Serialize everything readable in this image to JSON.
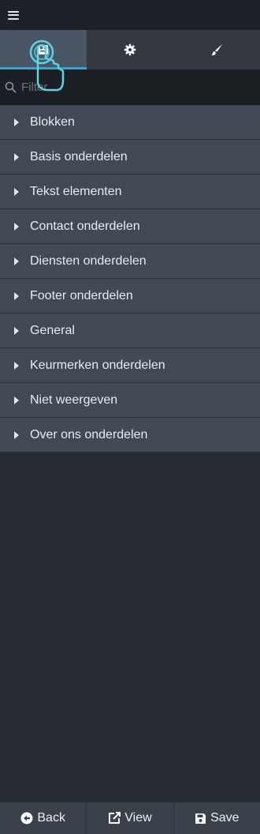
{
  "header": {
    "menu_icon": "hamburger-icon"
  },
  "tabs": [
    {
      "icon": "blocks-icon",
      "active": true
    },
    {
      "icon": "gear-icon",
      "active": false
    },
    {
      "icon": "brush-icon",
      "active": false
    }
  ],
  "filter": {
    "placeholder": "Filter",
    "value": ""
  },
  "categories": [
    {
      "label": "Blokken"
    },
    {
      "label": "Basis onderdelen"
    },
    {
      "label": "Tekst elementen"
    },
    {
      "label": "Contact onderdelen"
    },
    {
      "label": "Diensten onderdelen"
    },
    {
      "label": "Footer onderdelen"
    },
    {
      "label": "General"
    },
    {
      "label": "Keurmerken onderdelen"
    },
    {
      "label": "Niet weergeven"
    },
    {
      "label": "Over ons onderdelen"
    }
  ],
  "footer": {
    "back_label": "Back",
    "view_label": "View",
    "save_label": "Save"
  },
  "colors": {
    "accent": "#35a6c9",
    "background": "#262a31",
    "category_bg": "#414955"
  }
}
